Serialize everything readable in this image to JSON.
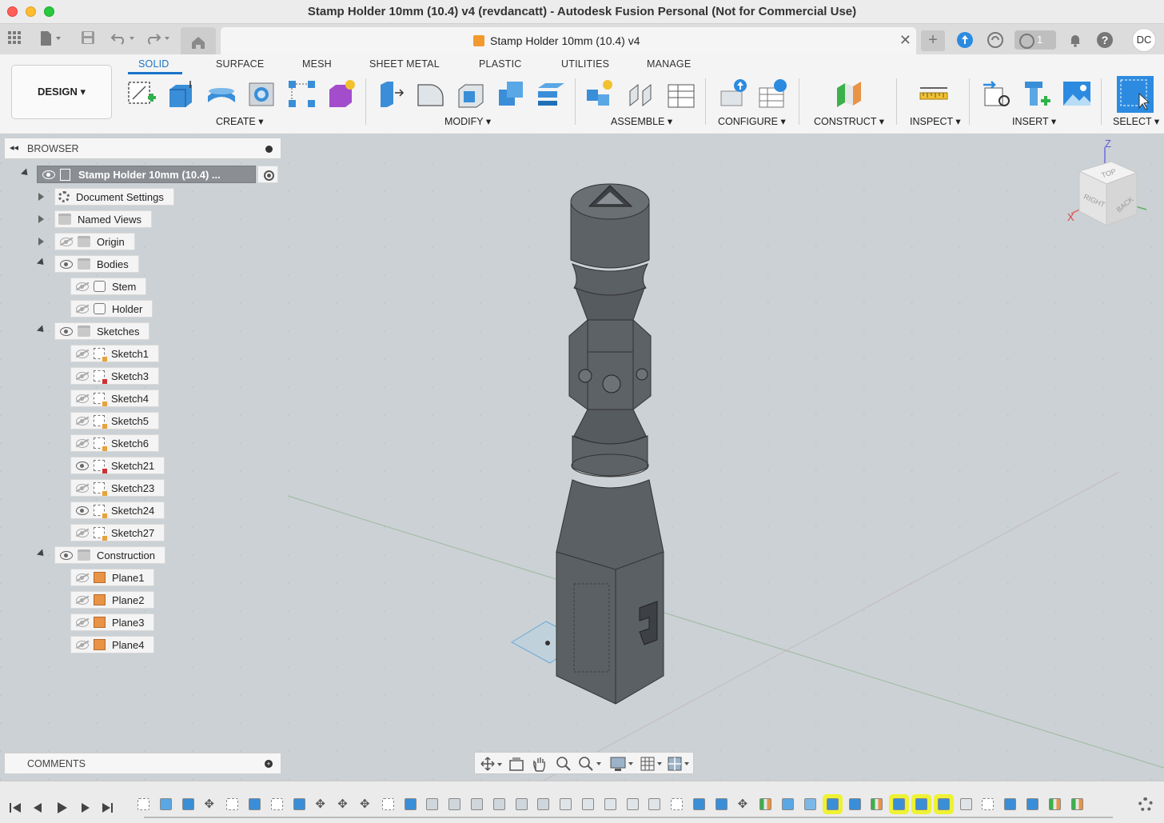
{
  "window": {
    "title": "Stamp Holder 10mm (10.4) v4 (revdancatt) - Autodesk Fusion Personal (Not for Commercial Use)"
  },
  "tabbar": {
    "doc_tab_label": "Stamp Holder 10mm (10.4) v4",
    "jobs_count": "1",
    "user_initials": "DC"
  },
  "toolbar": {
    "workspace": "DESIGN",
    "tabs": [
      "SOLID",
      "SURFACE",
      "MESH",
      "SHEET METAL",
      "PLASTIC",
      "UTILITIES",
      "MANAGE"
    ],
    "active_tab": "SOLID",
    "groups": [
      "CREATE",
      "MODIFY",
      "ASSEMBLE",
      "CONFIGURE",
      "CONSTRUCT",
      "INSPECT",
      "INSERT",
      "SELECT"
    ]
  },
  "browser": {
    "title": "BROWSER",
    "root_label": "Stamp Holder 10mm (10.4) ...",
    "items": [
      {
        "label": "Document Settings"
      },
      {
        "label": "Named Views"
      },
      {
        "label": "Origin"
      },
      {
        "label": "Bodies"
      },
      {
        "label": "Stem"
      },
      {
        "label": "Holder"
      },
      {
        "label": "Sketches"
      },
      {
        "label": "Sketch1"
      },
      {
        "label": "Sketch3"
      },
      {
        "label": "Sketch4"
      },
      {
        "label": "Sketch5"
      },
      {
        "label": "Sketch6"
      },
      {
        "label": "Sketch21"
      },
      {
        "label": "Sketch23"
      },
      {
        "label": "Sketch24"
      },
      {
        "label": "Sketch27"
      },
      {
        "label": "Construction"
      },
      {
        "label": "Plane1"
      },
      {
        "label": "Plane2"
      },
      {
        "label": "Plane3"
      },
      {
        "label": "Plane4"
      }
    ]
  },
  "comments": {
    "title": "COMMENTS"
  },
  "viewcube": {
    "z": "Z",
    "x": "X",
    "face_top": "TOP",
    "face_right": "RIGHT",
    "face_back": "BACK"
  },
  "colors": {
    "accent": "#1a74c8",
    "timeline_highlight": "#eef234",
    "model_body": "#5d6266"
  }
}
